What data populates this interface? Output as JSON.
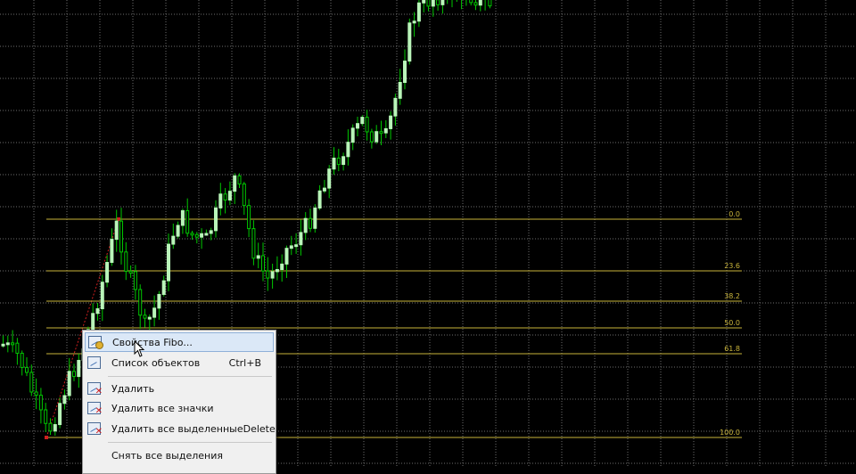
{
  "chart": {
    "background": "#000000",
    "grid_color": "#6e6e6e",
    "fib_color": "#c9b43a",
    "bull_color": "#b9f5b9",
    "bear_color": "#00c800",
    "fib_levels": [
      {
        "label": "0.0"
      },
      {
        "label": "23.6"
      },
      {
        "label": "38.2"
      },
      {
        "label": "50.0"
      },
      {
        "label": "61.8"
      },
      {
        "label": "100.0"
      }
    ]
  },
  "context_menu": {
    "items": [
      {
        "label": "Свойства Fibo...",
        "shortcut": "",
        "icon": "fibo-properties-icon"
      },
      {
        "label": "Список объектов",
        "shortcut": "Ctrl+B",
        "icon": "object-list-icon"
      },
      {
        "label": "Удалить",
        "shortcut": "",
        "icon": "delete-icon"
      },
      {
        "label": "Удалить все значки",
        "shortcut": "",
        "icon": "delete-all-arrows-icon"
      },
      {
        "label": "Удалить все выделенные",
        "shortcut": "Delete",
        "icon": "delete-selected-icon"
      },
      {
        "label": "Снять все выделения",
        "shortcut": "",
        "icon": ""
      }
    ]
  }
}
